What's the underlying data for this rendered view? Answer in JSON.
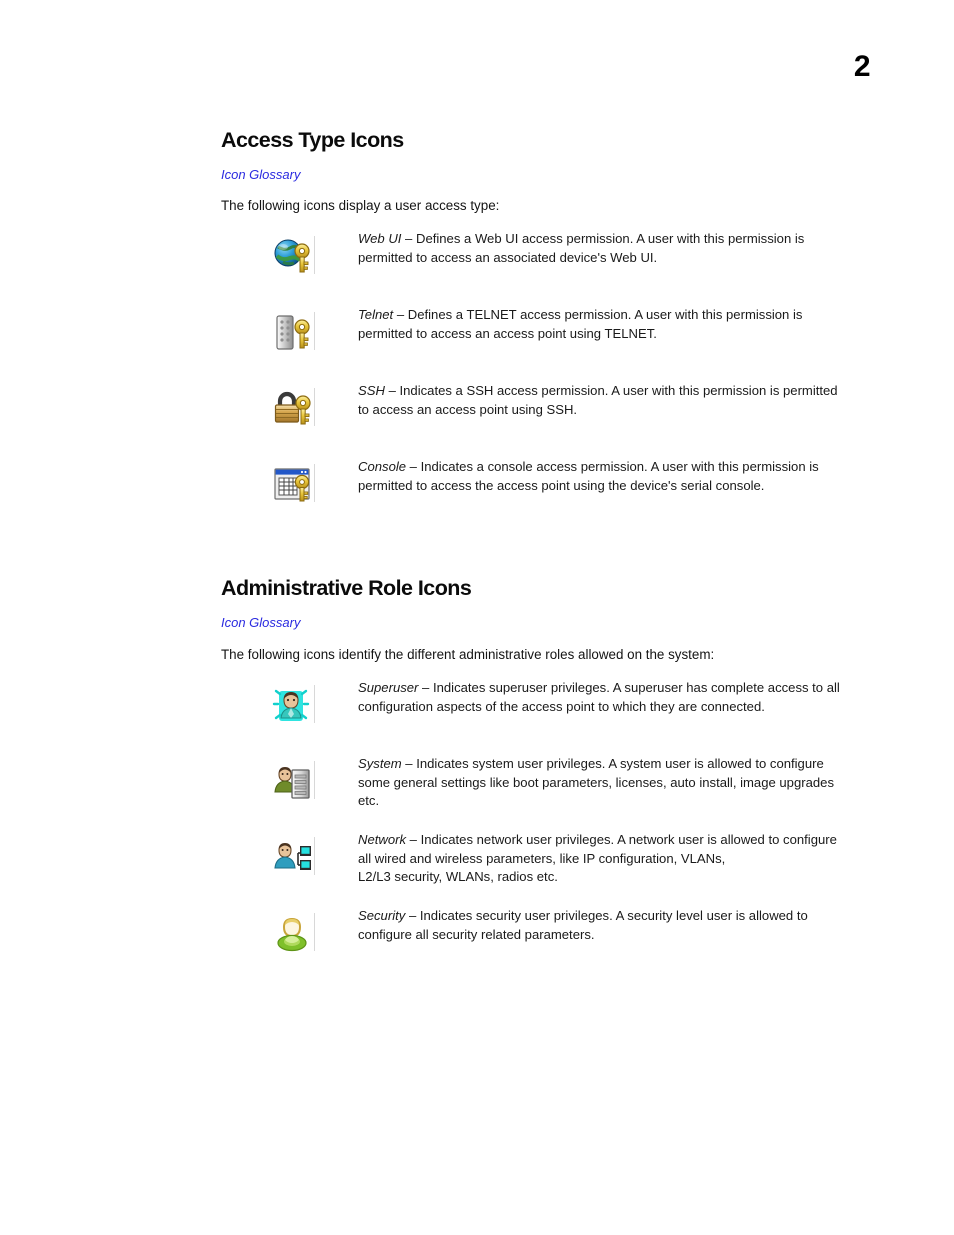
{
  "page": {
    "number": "2"
  },
  "sections": [
    {
      "id": "access-type-icons",
      "title": "Access Type Icons",
      "glossary_link": "Icon Glossary",
      "intro": "The following icons display a user access type:",
      "items": [
        {
          "icon": "globe-key-icon",
          "term": "Web UI",
          "dash": " – ",
          "text": "Defines a Web UI access permission. A user with this permission is permitted to access an associated device's Web UI."
        },
        {
          "icon": "telnet-terminal-key-icon",
          "term": "Telnet",
          "dash": " – ",
          "text": "Defines a TELNET access permission. A user with this permission is permitted to access an access point using TELNET."
        },
        {
          "icon": "padlock-key-icon",
          "term": "SSH",
          "dash": " – ",
          "text": "Indicates a SSH access permission. A user with this permission is permitted to access an access point using SSH."
        },
        {
          "icon": "console-window-key-icon",
          "term": "Console",
          "dash": " – ",
          "text": "Indicates a console access permission. A user with this permission is permitted to access the access point using the device's serial console."
        }
      ]
    },
    {
      "id": "administrative-role-icons",
      "title": "Administrative Role Icons",
      "glossary_link": "Icon Glossary",
      "intro": "The following icons identify the different administrative roles allowed on the system:",
      "items": [
        {
          "icon": "superuser-person-icon",
          "term": "Superuser",
          "dash": " – ",
          "text": "Indicates superuser privileges. A superuser has complete access to all configuration aspects of the access point to which they are connected."
        },
        {
          "icon": "system-user-server-icon",
          "term": "System",
          "dash": " – ",
          "text": "Indicates system user privileges. A system user is allowed to configure some general settings like boot parameters, licenses, auto install, image upgrades etc."
        },
        {
          "icon": "network-user-icon",
          "term": "Network",
          "dash": " – ",
          "text": "Indicates network user privileges. A network user is allowed to configure all wired and wireless parameters, like IP configuration, VLANs,",
          "text_line2": "L2/L3 security, WLANs, radios etc."
        },
        {
          "icon": "security-user-icon",
          "term": "Security",
          "dash": " – ",
          "text": "Indicates security user privileges. A security level user is allowed to configure all security related parameters."
        }
      ]
    }
  ],
  "colors": {
    "link_blue": "#2b2be0",
    "text": "#1a1a1a",
    "heading": "#0b0b0b"
  }
}
